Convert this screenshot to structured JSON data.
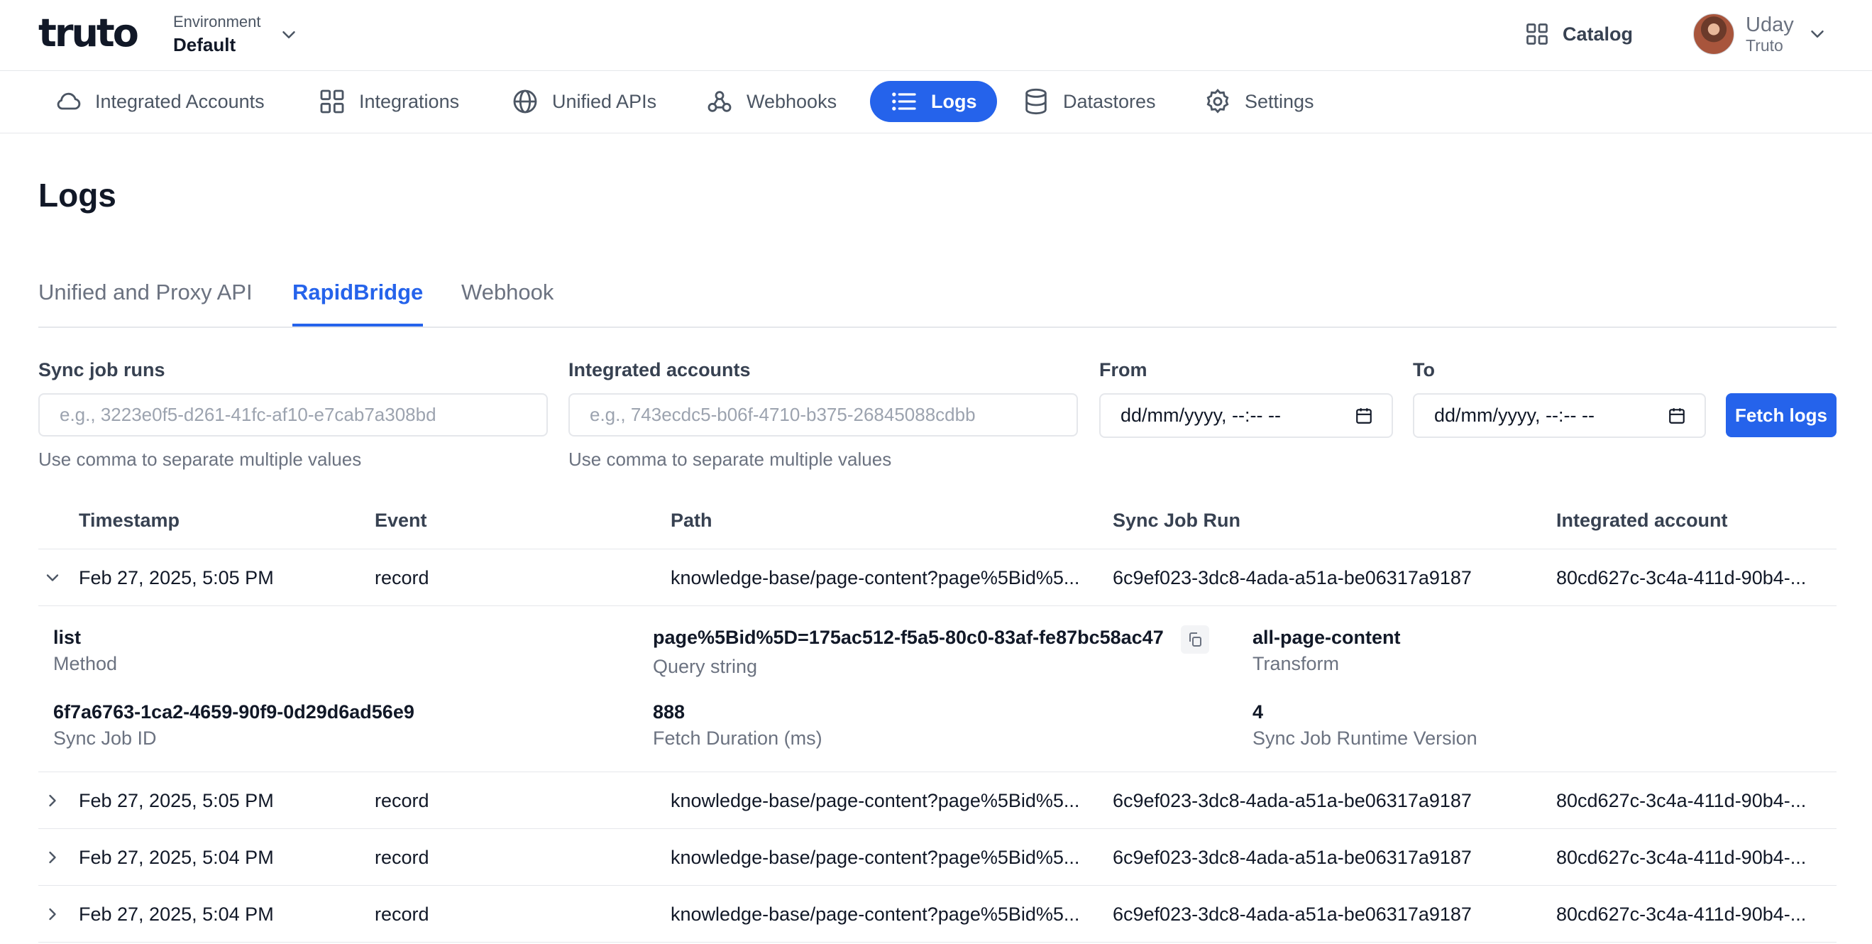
{
  "app": {
    "logo": "truto",
    "environment_label": "Environment",
    "environment_value": "Default",
    "catalog_label": "Catalog",
    "user_name": "Uday",
    "user_org": "Truto"
  },
  "nav": {
    "items": [
      {
        "label": "Integrated Accounts",
        "icon": "cloud-icon"
      },
      {
        "label": "Integrations",
        "icon": "grid-icon"
      },
      {
        "label": "Unified APIs",
        "icon": "globe-icon"
      },
      {
        "label": "Webhooks",
        "icon": "webhook-icon"
      },
      {
        "label": "Logs",
        "icon": "list-icon",
        "active": true
      },
      {
        "label": "Datastores",
        "icon": "database-icon"
      },
      {
        "label": "Settings",
        "icon": "gear-icon"
      }
    ]
  },
  "page": {
    "title": "Logs",
    "tabs": [
      {
        "label": "Unified and Proxy API"
      },
      {
        "label": "RapidBridge",
        "active": true
      },
      {
        "label": "Webhook"
      }
    ]
  },
  "filters": {
    "sync_job_runs": {
      "label": "Sync job runs",
      "placeholder": "e.g., 3223e0f5-d261-41fc-af10-e7cab7a308bd",
      "hint": "Use comma to separate multiple values"
    },
    "integrated_accounts": {
      "label": "Integrated accounts",
      "placeholder": "e.g., 743ecdc5-b06f-4710-b375-26845088cdbb",
      "hint": "Use comma to separate multiple values"
    },
    "from": {
      "label": "From",
      "value": "dd/mm/yyyy, --:-- --"
    },
    "to": {
      "label": "To",
      "value": "dd/mm/yyyy, --:-- --"
    },
    "fetch_label": "Fetch logs"
  },
  "table": {
    "columns": [
      "Timestamp",
      "Event",
      "Path",
      "Sync Job Run",
      "Integrated account"
    ],
    "rows": [
      {
        "timestamp": "Feb 27, 2025, 5:05 PM",
        "event": "record",
        "path": "knowledge-base/page-content?page%5Bid%5...",
        "sync_job_run": "6c9ef023-3dc8-4ada-a51a-be06317a9187",
        "integrated_account": "80cd627c-3c4a-411d-90b4-...",
        "expanded": true
      },
      {
        "timestamp": "Feb 27, 2025, 5:05 PM",
        "event": "record",
        "path": "knowledge-base/page-content?page%5Bid%5...",
        "sync_job_run": "6c9ef023-3dc8-4ada-a51a-be06317a9187",
        "integrated_account": "80cd627c-3c4a-411d-90b4-..."
      },
      {
        "timestamp": "Feb 27, 2025, 5:04 PM",
        "event": "record",
        "path": "knowledge-base/page-content?page%5Bid%5...",
        "sync_job_run": "6c9ef023-3dc8-4ada-a51a-be06317a9187",
        "integrated_account": "80cd627c-3c4a-411d-90b4-..."
      },
      {
        "timestamp": "Feb 27, 2025, 5:04 PM",
        "event": "record",
        "path": "knowledge-base/page-content?page%5Bid%5...",
        "sync_job_run": "6c9ef023-3dc8-4ada-a51a-be06317a9187",
        "integrated_account": "80cd627c-3c4a-411d-90b4-..."
      }
    ],
    "detail": {
      "method": {
        "value": "list",
        "label": "Method"
      },
      "query_string": {
        "value": "page%5Bid%5D=175ac512-f5a5-80c0-83af-fe87bc58ac47",
        "label": "Query string"
      },
      "transform": {
        "value": "all-page-content",
        "label": "Transform"
      },
      "sync_job_id": {
        "value": "6f7a6763-1ca2-4659-90f9-0d29d6ad56e9",
        "label": "Sync Job ID"
      },
      "fetch_duration": {
        "value": "888",
        "label": "Fetch Duration (ms)"
      },
      "runtime_version": {
        "value": "4",
        "label": "Sync Job Runtime Version"
      }
    }
  },
  "colors": {
    "accent": "#2563eb",
    "border": "#e5e7eb",
    "muted_text": "#6b7280"
  }
}
